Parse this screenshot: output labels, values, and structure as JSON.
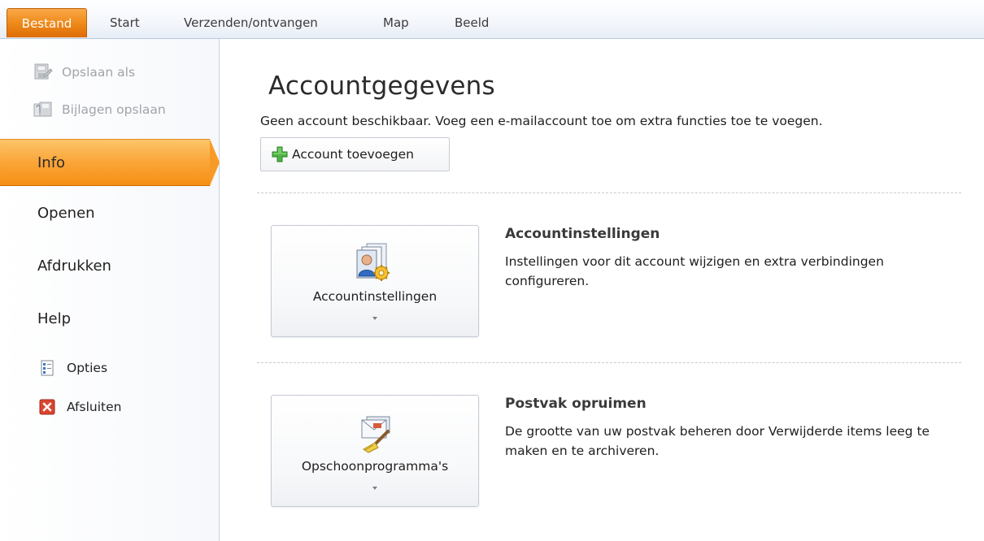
{
  "ribbon": {
    "tabs": [
      {
        "label": "Bestand",
        "active": true
      },
      {
        "label": "Start"
      },
      {
        "label": "Verzenden/ontvangen"
      },
      {
        "label": "Map"
      },
      {
        "label": "Beeld"
      }
    ]
  },
  "nav": {
    "save_as": {
      "label": "Opslaan als",
      "icon": "save-as-icon",
      "enabled": false
    },
    "save_attachments": {
      "label": "Bijlagen opslaan",
      "icon": "save-attachments-icon",
      "enabled": false
    },
    "info": {
      "label": "Info",
      "selected": true
    },
    "open": {
      "label": "Openen"
    },
    "print": {
      "label": "Afdrukken"
    },
    "help": {
      "label": "Help"
    },
    "options": {
      "label": "Opties",
      "icon": "options-icon"
    },
    "exit": {
      "label": "Afsluiten",
      "icon": "exit-icon"
    }
  },
  "main": {
    "title": "Accountgegevens",
    "subtitle": "Geen account beschikbaar. Voeg een e-mailaccount toe om extra functies toe te voegen.",
    "add_account_label": "Account toevoegen",
    "sections": [
      {
        "button_label": "Accountinstellingen",
        "button_icon": "account-settings-icon",
        "title": "Accountinstellingen",
        "description": "Instellingen voor dit account wijzigen en extra verbindingen configureren."
      },
      {
        "button_label": "Opschoonprogramma's",
        "button_icon": "mailbox-cleanup-icon",
        "title": "Postvak opruimen",
        "description": "De grootte van uw postvak beheren door Verwijderde items leeg te maken en te archiveren."
      }
    ]
  },
  "colors": {
    "file_tab": "#f08d1e",
    "selected_nav": "#fba73c",
    "separator": "#c9c9c9"
  }
}
